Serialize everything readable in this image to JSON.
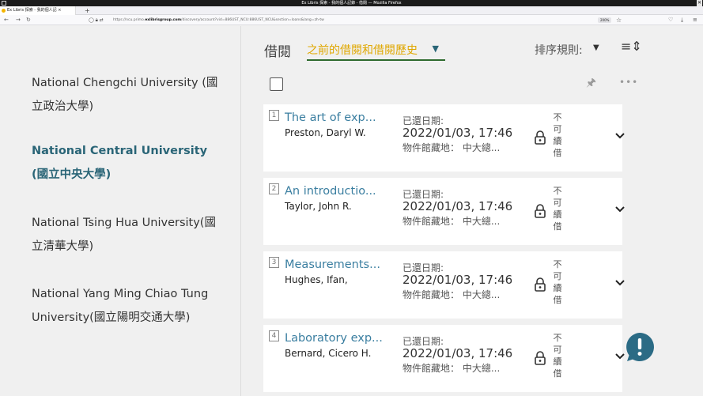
{
  "browser": {
    "window_title": "Ex Libris 探索 - 我的個人記錄 - 借閱 — Mozilla Firefox",
    "tab_title": "Ex Libris 探索 - 我的個人記 ×",
    "new_tab": "+",
    "url_prefix": "https://ncu.primo.",
    "url_domain": "exlibrisgroup.com",
    "url_rest": "/discovery/account?vid=886UST_NCU:886UST_NCU&section=loans&lang=zh-tw",
    "zoom": "200%"
  },
  "sidebar": {
    "institutions": [
      {
        "line1": "National Chengchi University (國",
        "line2": "立政治大學)"
      },
      {
        "line1": "National Central University",
        "line2": "(國立中央大學)"
      },
      {
        "line1": "National Tsing Hua University(國",
        "line2": "立清華大學)"
      },
      {
        "line1": "National Yang Ming Chiao Tung",
        "line2": "University(國立陽明交通大學)"
      }
    ]
  },
  "main": {
    "section_title": "借閱",
    "history_option": "之前的借閱和借閱歷史",
    "sort_label": "排序規則:",
    "more": "•••",
    "loans": [
      {
        "num": "1",
        "title": "The art of exp...",
        "author": "Preston, Daryl W.",
        "due_label": "已還日期:",
        "due_date": "2022/01/03, 17:46",
        "location": "物件館藏地： 中大總...",
        "renew": [
          "不",
          "可",
          "續",
          "借"
        ]
      },
      {
        "num": "2",
        "title": "An introductio...",
        "author": "Taylor, John R.",
        "due_label": "已還日期:",
        "due_date": "2022/01/03, 17:46",
        "location": "物件館藏地： 中大總...",
        "renew": [
          "不",
          "可",
          "續",
          "借"
        ]
      },
      {
        "num": "3",
        "title": "Measurements...",
        "author": "Hughes, Ifan,",
        "due_label": "已還日期:",
        "due_date": "2022/01/03, 17:46",
        "location": "物件館藏地： 中大總...",
        "renew": [
          "不",
          "可",
          "續",
          "借"
        ]
      },
      {
        "num": "4",
        "title": "Laboratory exp...",
        "author": "Bernard, Cicero H.",
        "due_label": "已還日期:",
        "due_date": "2022/01/03, 17:46",
        "location": "物件館藏地： 中大總...",
        "renew": [
          "不",
          "可",
          "續",
          "借"
        ]
      }
    ]
  },
  "colors": {
    "accent_link": "#3a7ea0",
    "active_institution": "#2a6577",
    "history_text": "#e0a700",
    "fab": "#2b6b85"
  }
}
